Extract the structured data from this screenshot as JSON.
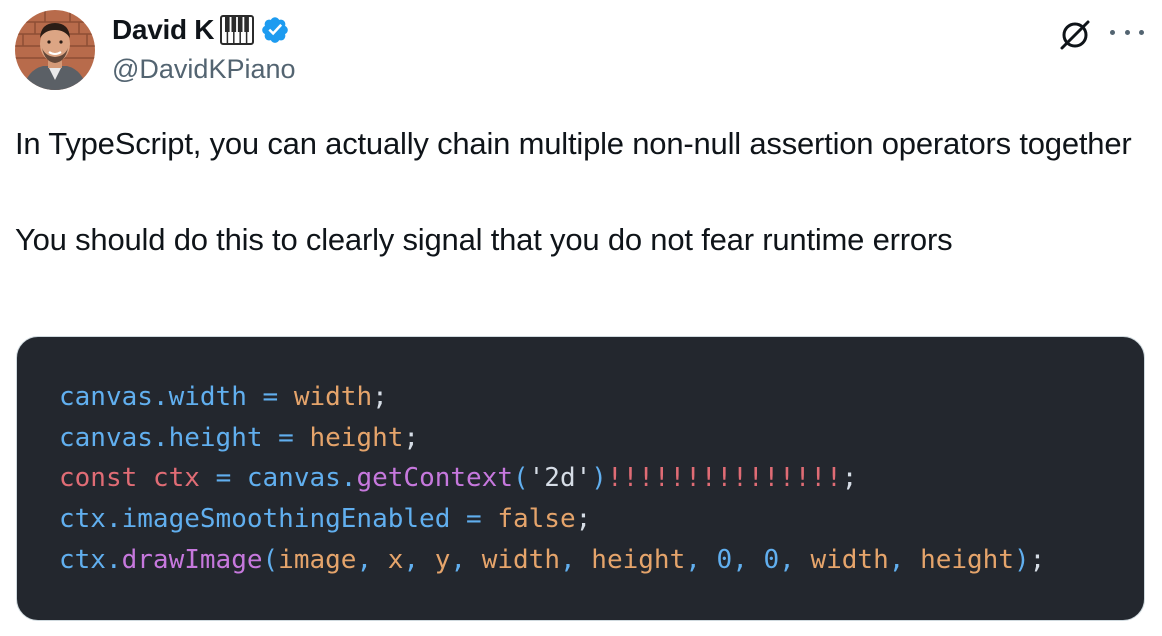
{
  "author": {
    "display_name": "David K",
    "emoji_icon": "piano-keys-icon",
    "verified_icon": "verified-badge-icon",
    "verified_color": "#1d9bf0",
    "handle": "@DavidKPiano"
  },
  "header_actions": {
    "grok_icon": "grok-icon",
    "more_icon": "more-options-icon"
  },
  "tweet": {
    "paragraph_1": "In TypeScript, you can actually chain multiple non-null assertion operators together",
    "paragraph_2": "You should do this to clearly signal that you do not fear runtime errors"
  },
  "code_block": {
    "background": "#23272e",
    "lines": [
      "canvas.width = width;",
      "canvas.height = height;",
      "const ctx = canvas.getContext('2d')!!!!!!!!!!!!!!!;",
      "ctx.imageSmoothingEnabled = false;",
      "ctx.drawImage(image, x, y, width, height, 0, 0, width, height);"
    ]
  }
}
